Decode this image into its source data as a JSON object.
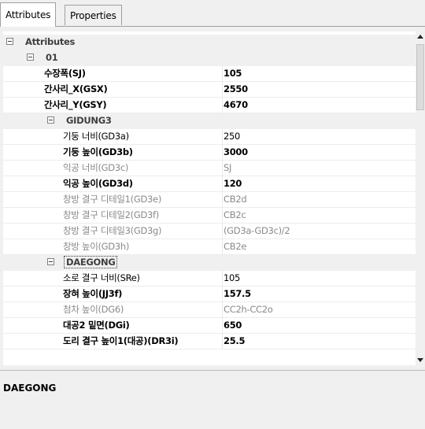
{
  "tabs": [
    {
      "label": "Attributes",
      "active": true
    },
    {
      "label": "Properties",
      "active": false
    }
  ],
  "grid": {
    "root": {
      "label": "Attributes"
    },
    "group": {
      "label": "01"
    },
    "top_props": [
      {
        "name": "수장폭(SJ)",
        "value": "105",
        "style": "bold"
      },
      {
        "name": "간사리_X(GSX)",
        "value": "2550",
        "style": "bold"
      },
      {
        "name": "간사리_Y(GSY)",
        "value": "4670",
        "style": "bold"
      }
    ],
    "categories": [
      {
        "label": "GIDUNG3",
        "props": [
          {
            "name": "기둥 너비(GD3a)",
            "value": "250",
            "style": "norm"
          },
          {
            "name": "기둥 높이(GD3b)",
            "value": "3000",
            "style": "bold"
          },
          {
            "name": "익공 너비(GD3c)",
            "value": "SJ",
            "style": "dim"
          },
          {
            "name": "익공 높이(GD3d)",
            "value": "120",
            "style": "bold"
          },
          {
            "name": "창방 결구 디테일1(GD3e)",
            "value": "CB2d",
            "style": "dim"
          },
          {
            "name": "창방 결구 디테일2(GD3f)",
            "value": "CB2c",
            "style": "dim"
          },
          {
            "name": "창방 결구 디테일3(GD3g)",
            "value": "(GD3a-GD3c)/2",
            "style": "dim"
          },
          {
            "name": "창방 높이(GD3h)",
            "value": "CB2e",
            "style": "dim"
          }
        ]
      },
      {
        "label": "DAEGONG",
        "props": [
          {
            "name": "소로 결구 너비(SRe)",
            "value": "105",
            "style": "norm"
          },
          {
            "name": "장혀 높이(JJ3f)",
            "value": "157.5",
            "style": "bold"
          },
          {
            "name": "첨차 높이(DG6)",
            "value": "CC2h-CC2o",
            "style": "dim"
          },
          {
            "name": "대공2 밑면(DGi)",
            "value": "650",
            "style": "bold"
          },
          {
            "name": "도리 결구 높이1(대공)(DR3i)",
            "value": "25.5",
            "style": "bold"
          }
        ]
      }
    ]
  },
  "description": {
    "title": "DAEGONG"
  },
  "icons": {
    "collapse": "minus-box-icon",
    "scroll_up": "arrow-up-icon",
    "scroll_down": "arrow-down-icon"
  }
}
